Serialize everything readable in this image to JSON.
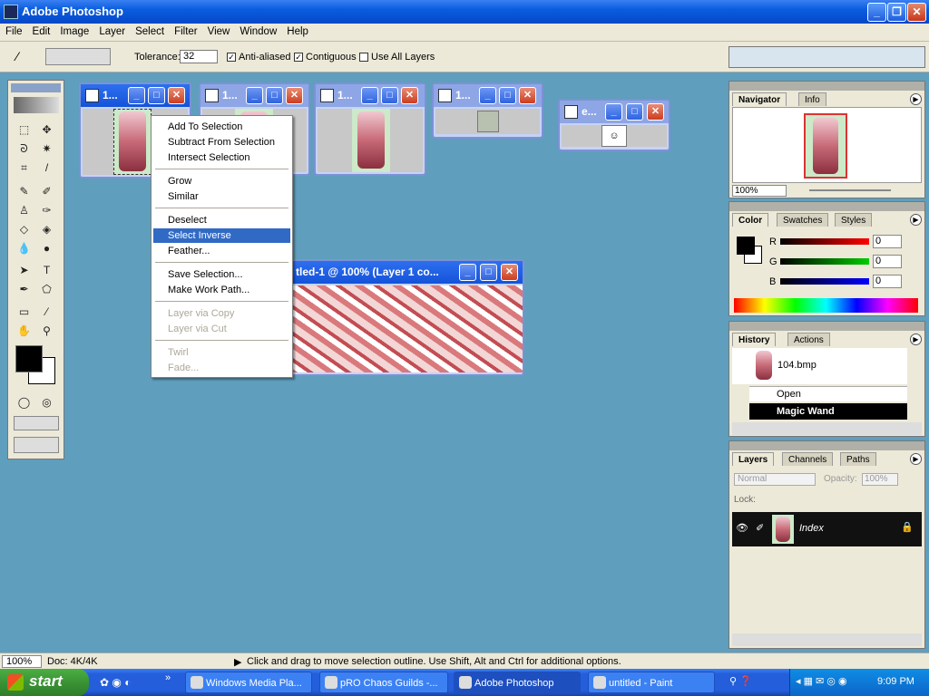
{
  "app": {
    "title": "Adobe Photoshop"
  },
  "menubar": [
    "File",
    "Edit",
    "Image",
    "Layer",
    "Select",
    "Filter",
    "View",
    "Window",
    "Help"
  ],
  "options": {
    "tolerance_label": "Tolerance:",
    "tolerance_value": "32",
    "antialiased_label": "Anti-aliased",
    "contiguous_label": "Contiguous",
    "use_all_layers_label": "Use All Layers"
  },
  "documents": [
    {
      "title": "1..."
    },
    {
      "title": "1..."
    },
    {
      "title": "1..."
    },
    {
      "title": "1..."
    },
    {
      "title": "e..."
    },
    {
      "title": "tled-1 @ 100% (Layer 1 co..."
    }
  ],
  "context_menu": {
    "items": [
      "Add To Selection",
      "Subtract From Selection",
      "Intersect Selection",
      "Grow",
      "Similar",
      "Deselect",
      "Select Inverse",
      "Feather...",
      "Save Selection...",
      "Make Work Path...",
      "Layer via Copy",
      "Layer via Cut",
      "Twirl",
      "Fade..."
    ]
  },
  "navigator": {
    "tabs": [
      "Navigator",
      "Info"
    ],
    "zoom": "100%"
  },
  "color": {
    "tabs": [
      "Color",
      "Swatches",
      "Styles"
    ],
    "channels": [
      {
        "label": "R",
        "value": "0"
      },
      {
        "label": "G",
        "value": "0"
      },
      {
        "label": "B",
        "value": "0"
      }
    ]
  },
  "history": {
    "tabs": [
      "History",
      "Actions"
    ],
    "snapshot": "104.bmp",
    "items": [
      "Open",
      "Magic Wand"
    ]
  },
  "layers": {
    "tabs": [
      "Layers",
      "Channels",
      "Paths"
    ],
    "blend_mode": "Normal",
    "opacity_label": "Opacity:",
    "opacity_value": "100%",
    "lock_label": "Lock:",
    "layer_name": "Index"
  },
  "status": {
    "zoom": "100%",
    "doc": "Doc: 4K/4K",
    "hint": "Click and drag to move selection outline.  Use Shift, Alt and Ctrl for additional options."
  },
  "taskbar": {
    "start": "start",
    "tasks": [
      "Windows Media Pla...",
      "pRO Chaos Guilds -...",
      "Adobe Photoshop",
      "untitled - Paint"
    ],
    "time": "9:09 PM"
  },
  "colors": {
    "desktop": "#5f9ebc",
    "accent": "#316ac5",
    "xp_blue": "#245edb"
  }
}
